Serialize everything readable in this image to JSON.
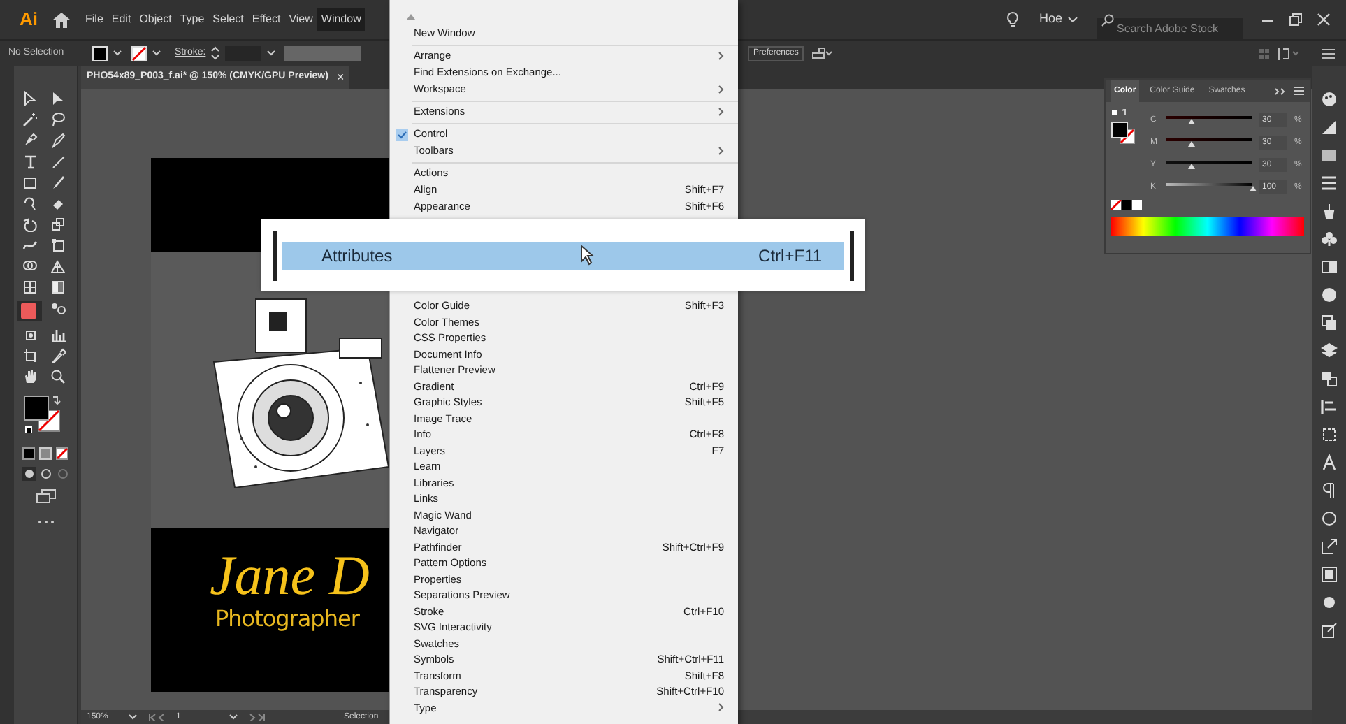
{
  "app_bar": {
    "logo": "Ai",
    "menus": [
      {
        "label": "File",
        "selected": false
      },
      {
        "label": "Edit",
        "selected": false
      },
      {
        "label": "Object",
        "selected": false
      },
      {
        "label": "Type",
        "selected": false
      },
      {
        "label": "Select",
        "selected": false
      },
      {
        "label": "Effect",
        "selected": false
      },
      {
        "label": "View",
        "selected": false
      },
      {
        "label": "Window",
        "selected": true
      }
    ],
    "workspace": "Hoe",
    "search": {
      "placeholder": "Search Adobe Stock"
    }
  },
  "control_bar": {
    "selection": "No Selection",
    "stroke_label": "Stroke:",
    "preferences_button": "Preferences"
  },
  "document_tab": {
    "title": "PHO54x89_P003_f.ai* @ 150% (CMYK/GPU Preview)",
    "close": "×"
  },
  "artboard": {
    "name": "Jane D",
    "subtitle": "Photographer"
  },
  "window_menu": {
    "items_top": [
      {
        "kind": "item",
        "label": "New Window",
        "submenu": false,
        "checked": false
      },
      {
        "kind": "separator"
      },
      {
        "kind": "item",
        "label": "Arrange",
        "submenu": true,
        "checked": false
      },
      {
        "kind": "item",
        "label": "Find Extensions on Exchange...",
        "submenu": false,
        "checked": false
      },
      {
        "kind": "item",
        "label": "Workspace",
        "submenu": true,
        "checked": false
      },
      {
        "kind": "separator"
      },
      {
        "kind": "item",
        "label": "Extensions",
        "submenu": true,
        "checked": false
      },
      {
        "kind": "separator"
      },
      {
        "kind": "item",
        "label": "Control",
        "submenu": false,
        "checked": true
      },
      {
        "kind": "item",
        "label": "Toolbars",
        "submenu": true,
        "checked": false
      },
      {
        "kind": "separator"
      },
      {
        "kind": "item",
        "label": "Actions",
        "submenu": false,
        "checked": false
      },
      {
        "kind": "item",
        "label": "Align",
        "shortcut": "Shift+F7",
        "submenu": false,
        "checked": false
      },
      {
        "kind": "item",
        "label": "Appearance",
        "shortcut": "Shift+F6",
        "submenu": false,
        "checked": false
      }
    ],
    "items_bottom": [
      {
        "kind": "item",
        "label": "Color Guide",
        "shortcut": "Shift+F3",
        "submenu": false,
        "checked": false
      },
      {
        "kind": "item",
        "label": "Color Themes",
        "submenu": false,
        "checked": false
      },
      {
        "kind": "item",
        "label": "CSS Properties",
        "submenu": false,
        "checked": false
      },
      {
        "kind": "item",
        "label": "Document Info",
        "submenu": false,
        "checked": false
      },
      {
        "kind": "item",
        "label": "Flattener Preview",
        "submenu": false,
        "checked": false
      },
      {
        "kind": "item",
        "label": "Gradient",
        "shortcut": "Ctrl+F9",
        "submenu": false,
        "checked": false
      },
      {
        "kind": "item",
        "label": "Graphic Styles",
        "shortcut": "Shift+F5",
        "submenu": false,
        "checked": false
      },
      {
        "kind": "item",
        "label": "Image Trace",
        "submenu": false,
        "checked": false
      },
      {
        "kind": "item",
        "label": "Info",
        "shortcut": "Ctrl+F8",
        "submenu": false,
        "checked": false
      },
      {
        "kind": "item",
        "label": "Layers",
        "shortcut": "F7",
        "submenu": false,
        "checked": false
      },
      {
        "kind": "item",
        "label": "Learn",
        "submenu": false,
        "checked": false
      },
      {
        "kind": "item",
        "label": "Libraries",
        "submenu": false,
        "checked": false
      },
      {
        "kind": "item",
        "label": "Links",
        "submenu": false,
        "checked": false
      },
      {
        "kind": "item",
        "label": "Magic Wand",
        "submenu": false,
        "checked": false
      },
      {
        "kind": "item",
        "label": "Navigator",
        "submenu": false,
        "checked": false
      },
      {
        "kind": "item",
        "label": "Pathfinder",
        "shortcut": "Shift+Ctrl+F9",
        "submenu": false,
        "checked": false
      },
      {
        "kind": "item",
        "label": "Pattern Options",
        "submenu": false,
        "checked": false
      },
      {
        "kind": "item",
        "label": "Properties",
        "submenu": false,
        "checked": false
      },
      {
        "kind": "item",
        "label": "Separations Preview",
        "submenu": false,
        "checked": false
      },
      {
        "kind": "item",
        "label": "Stroke",
        "shortcut": "Ctrl+F10",
        "submenu": false,
        "checked": false
      },
      {
        "kind": "item",
        "label": "SVG Interactivity",
        "submenu": false,
        "checked": false
      },
      {
        "kind": "item",
        "label": "Swatches",
        "submenu": false,
        "checked": false
      },
      {
        "kind": "item",
        "label": "Symbols",
        "shortcut": "Shift+Ctrl+F11",
        "submenu": false,
        "checked": false
      },
      {
        "kind": "item",
        "label": "Transform",
        "shortcut": "Shift+F8",
        "submenu": false,
        "checked": false
      },
      {
        "kind": "item",
        "label": "Transparency",
        "shortcut": "Shift+Ctrl+F10",
        "submenu": false,
        "checked": false
      },
      {
        "kind": "item",
        "label": "Type",
        "submenu": true,
        "checked": false
      }
    ]
  },
  "zoom_callout": {
    "label": "Attributes",
    "shortcut": "Ctrl+F11",
    "selected": true
  },
  "color_panel": {
    "tabs": [
      {
        "label": "Color",
        "selected": true
      },
      {
        "label": "Color Guide",
        "selected": false
      },
      {
        "label": "Swatches",
        "selected": false
      }
    ],
    "channels": [
      {
        "name": "C",
        "level": 0.3,
        "value": "30",
        "unit": "%"
      },
      {
        "name": "M",
        "level": 0.3,
        "value": "30",
        "unit": "%"
      },
      {
        "name": "Y",
        "level": 0.3,
        "value": "30",
        "unit": "%"
      },
      {
        "name": "K",
        "level": 1.0,
        "value": "100",
        "unit": "%"
      }
    ]
  },
  "status_bar": {
    "zoom": "150%",
    "artboard": "1",
    "tool": "Selection"
  }
}
